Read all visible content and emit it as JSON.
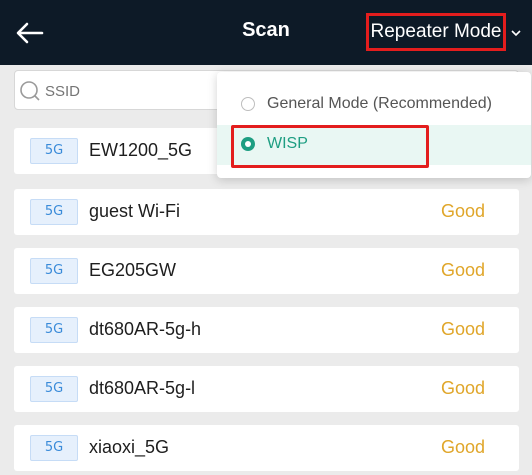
{
  "header": {
    "title": "Scan",
    "mode_label": "Repeater Mode"
  },
  "search": {
    "placeholder": "SSID"
  },
  "dropdown": {
    "options": [
      {
        "label": "General Mode (Recommended)",
        "selected": false
      },
      {
        "label": "WISP",
        "selected": true
      }
    ]
  },
  "networks": [
    {
      "band": "5G",
      "ssid": "EW1200_5G",
      "signal": ""
    },
    {
      "band": "5G",
      "ssid": "guest Wi-Fi",
      "signal": "Good"
    },
    {
      "band": "5G",
      "ssid": "EG205GW",
      "signal": "Good"
    },
    {
      "band": "5G",
      "ssid": "dt680AR-5g-h",
      "signal": "Good"
    },
    {
      "band": "5G",
      "ssid": "dt680AR-5g-l",
      "signal": "Good"
    },
    {
      "band": "5G",
      "ssid": "xiaoxi_5G",
      "signal": "Good"
    }
  ],
  "colors": {
    "header_bg": "#0d1a27",
    "accent": "#1e9e82",
    "signal_good": "#e0a62a",
    "highlight": "#e31d1d"
  }
}
